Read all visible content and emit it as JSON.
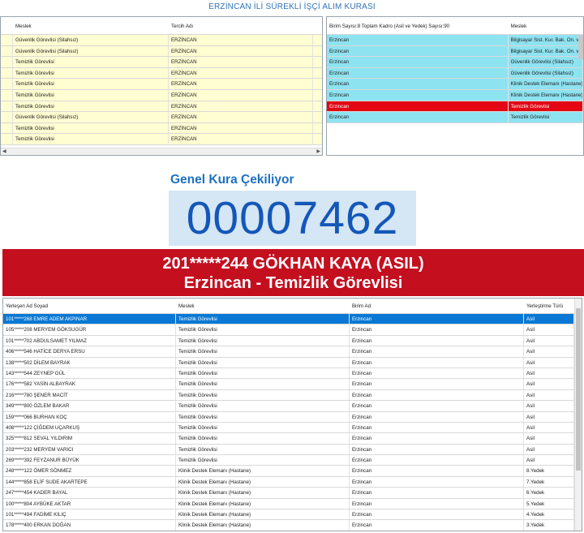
{
  "app_title": "ERZİNCAN İLİ SÜREKLİ İŞÇİ ALIM KURASI",
  "left_grid": {
    "headers": [
      "Meslek",
      "Tercih Adı"
    ],
    "rows": [
      [
        "Güvenlik Görevlisi (Silahsız)",
        "ERZİNCAN"
      ],
      [
        "Güvenlik Görevlisi (Silahsız)",
        "ERZİNCAN"
      ],
      [
        "Temizlik Görevlisi",
        "ERZİNCAN"
      ],
      [
        "Temizlik Görevlisi",
        "ERZİNCAN"
      ],
      [
        "Temizlik Görevlisi",
        "ERZİNCAN"
      ],
      [
        "Temizlik Görevlisi",
        "ERZİNCAN"
      ],
      [
        "Temizlik Görevlisi",
        "ERZİNCAN"
      ],
      [
        "Güvenlik Görevlisi (Silahsız)",
        "ERZİNCAN"
      ],
      [
        "Temizlik Görevlisi",
        "ERZİNCAN"
      ],
      [
        "Temizlik Görevlisi",
        "ERZİNCAN"
      ]
    ]
  },
  "right_grid": {
    "headers": [
      "Birim Sayısı:8 Toplam Kadro (Asil ve Yedek) Sayısı:90",
      "Meslek"
    ],
    "rows": [
      [
        "Erzincan",
        "Bilgisayar Sist. Kur. Bak. On. ve"
      ],
      [
        "Erzincan",
        "Bilgisayar Sist. Kur. Bak. On. ve"
      ],
      [
        "Erzincan",
        "Güvenlik Görevlisi (Silahsız)"
      ],
      [
        "Erzincan",
        "Güvenlik Görevlisi (Silahsız)"
      ],
      [
        "Erzincan",
        "Klinik Destek Elemanı (Hastane)"
      ],
      [
        "Erzincan",
        "Klinik Destek Elemanı (Hastane)"
      ],
      [
        "Erzincan",
        "Temizlik Görevlisi"
      ],
      [
        "Erzincan",
        "Temizlik Görevlisi"
      ]
    ],
    "selected_index": 6
  },
  "kura": {
    "status_label": "Genel Kura Çekiliyor",
    "number": "00007462",
    "winner_line": "201*****244 GÖKHAN KAYA (ASIL)",
    "winner_unit": "Erzincan - Temizlik Görevlisi"
  },
  "bottom_grid": {
    "headers": [
      "Yerleşen Ad Soyad",
      "Meslek",
      "Birim Ad",
      "Yerleştirme Türü"
    ],
    "rows": [
      [
        "101*****268 EMRE ADEM AKPINAR",
        "Temizlik Görevlisi",
        "Erzincan",
        "Asil"
      ],
      [
        "105*****208 MERYEM GÖKSUGÜR",
        "Temizlik Görevlisi",
        "Erzincan",
        "Asil"
      ],
      [
        "101*****702 ABDULSAMET YILMAZ",
        "Temizlik Görevlisi",
        "Erzincan",
        "Asil"
      ],
      [
        "406*****546 HATİCE DERYA ERSU",
        "Temizlik Görevlisi",
        "Erzincan",
        "Asil"
      ],
      [
        "138*****502 DİLEM BAYRAK",
        "Temizlik Görevlisi",
        "Erzincan",
        "Asil"
      ],
      [
        "143*****544 ZEYNEP GÜL",
        "Temizlik Görevlisi",
        "Erzincan",
        "Asil"
      ],
      [
        "176*****582 YASİN ALBAYRAK",
        "Temizlik Görevlisi",
        "Erzincan",
        "Asil"
      ],
      [
        "216*****780 ŞENER MACİT",
        "Temizlik Görevlisi",
        "Erzincan",
        "Asil"
      ],
      [
        "349*****800 ÖZLEM BAKAR",
        "Temizlik Görevlisi",
        "Erzincan",
        "Asil"
      ],
      [
        "159*****066 BURHAN KOÇ",
        "Temizlik Görevlisi",
        "Erzincan",
        "Asil"
      ],
      [
        "408*****122 ÇİĞDEM UÇARKUŞ",
        "Temizlik Görevlisi",
        "Erzincan",
        "Asil"
      ],
      [
        "325*****812 SEVAL YILDIRIM",
        "Temizlik Görevlisi",
        "Erzincan",
        "Asil"
      ],
      [
        "203*****232 MERYEM VARICI",
        "Temizlik Görevlisi",
        "Erzincan",
        "Asil"
      ],
      [
        "269*****392 FEYZANUR BÜYÜK",
        "Temizlik Görevlisi",
        "Erzincan",
        "Asil"
      ],
      [
        "248*****122 ÖMER SÖNMEZ",
        "Klinik Destek Elemanı (Hastane)",
        "Erzincan",
        "8.Yedek"
      ],
      [
        "144*****858 ELİF SUDE AKARTEPE",
        "Klinik Destek Elemanı (Hastane)",
        "Erzincan",
        "7.Yedek"
      ],
      [
        "247*****454 KADER BAYAL",
        "Klinik Destek Elemanı (Hastane)",
        "Erzincan",
        "6.Yedek"
      ],
      [
        "100*****804 AYBÜKE AKTAR",
        "Klinik Destek Elemanı (Hastane)",
        "Erzincan",
        "5.Yedek"
      ],
      [
        "101*****494 FADİME KILIÇ",
        "Klinik Destek Elemanı (Hastane)",
        "Erzincan",
        "4.Yedek"
      ],
      [
        "178*****400 ERKAN DOĞAN",
        "Klinik Destek Elemanı (Hastane)",
        "Erzincan",
        "3.Yedek"
      ]
    ],
    "selected_index": 0
  }
}
